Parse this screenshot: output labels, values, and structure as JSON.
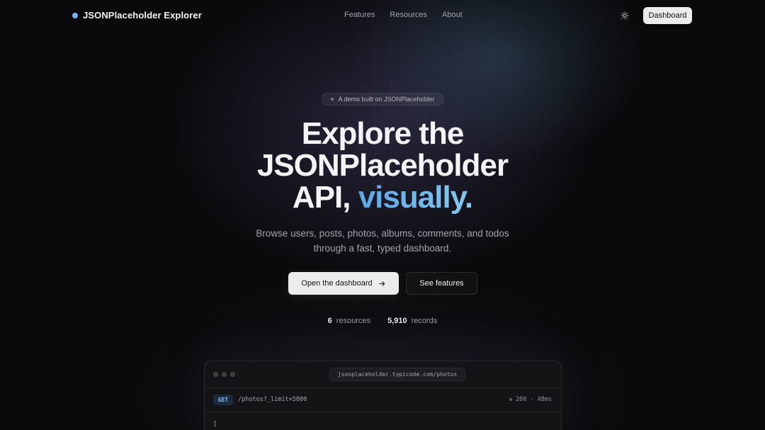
{
  "nav": {
    "brand": "JSONPlaceholder Explorer",
    "links": [
      "Features",
      "Resources",
      "About"
    ],
    "theme_icon": "sun-icon",
    "dashboard_label": "Dashboard"
  },
  "hero": {
    "badge": "A demo built on JSONPlaceholder",
    "headline_line1": "Explore the",
    "headline_line2": "JSONPlaceholder",
    "headline_line3_plain": "API,",
    "headline_line3_accent": "visually.",
    "subtitle_line1": "Browse users, posts, photos, albums, comments, and todos",
    "subtitle_line2": "through a fast, typed dashboard.",
    "primary_cta": "Open the dashboard",
    "secondary_cta": "See features",
    "stats": [
      {
        "value": "6",
        "label": "resources"
      },
      {
        "value": "5,910",
        "label": "records"
      }
    ]
  },
  "window": {
    "url": "jsonplaceholder.typicode.com/photos",
    "method": "GET",
    "path": "/photos?_limit=5000",
    "status_code": "200",
    "separator": "·",
    "latency": "48ms",
    "body_first_line": "["
  },
  "colors": {
    "accent": "#6fb3f0",
    "background": "#0a0a0c"
  }
}
